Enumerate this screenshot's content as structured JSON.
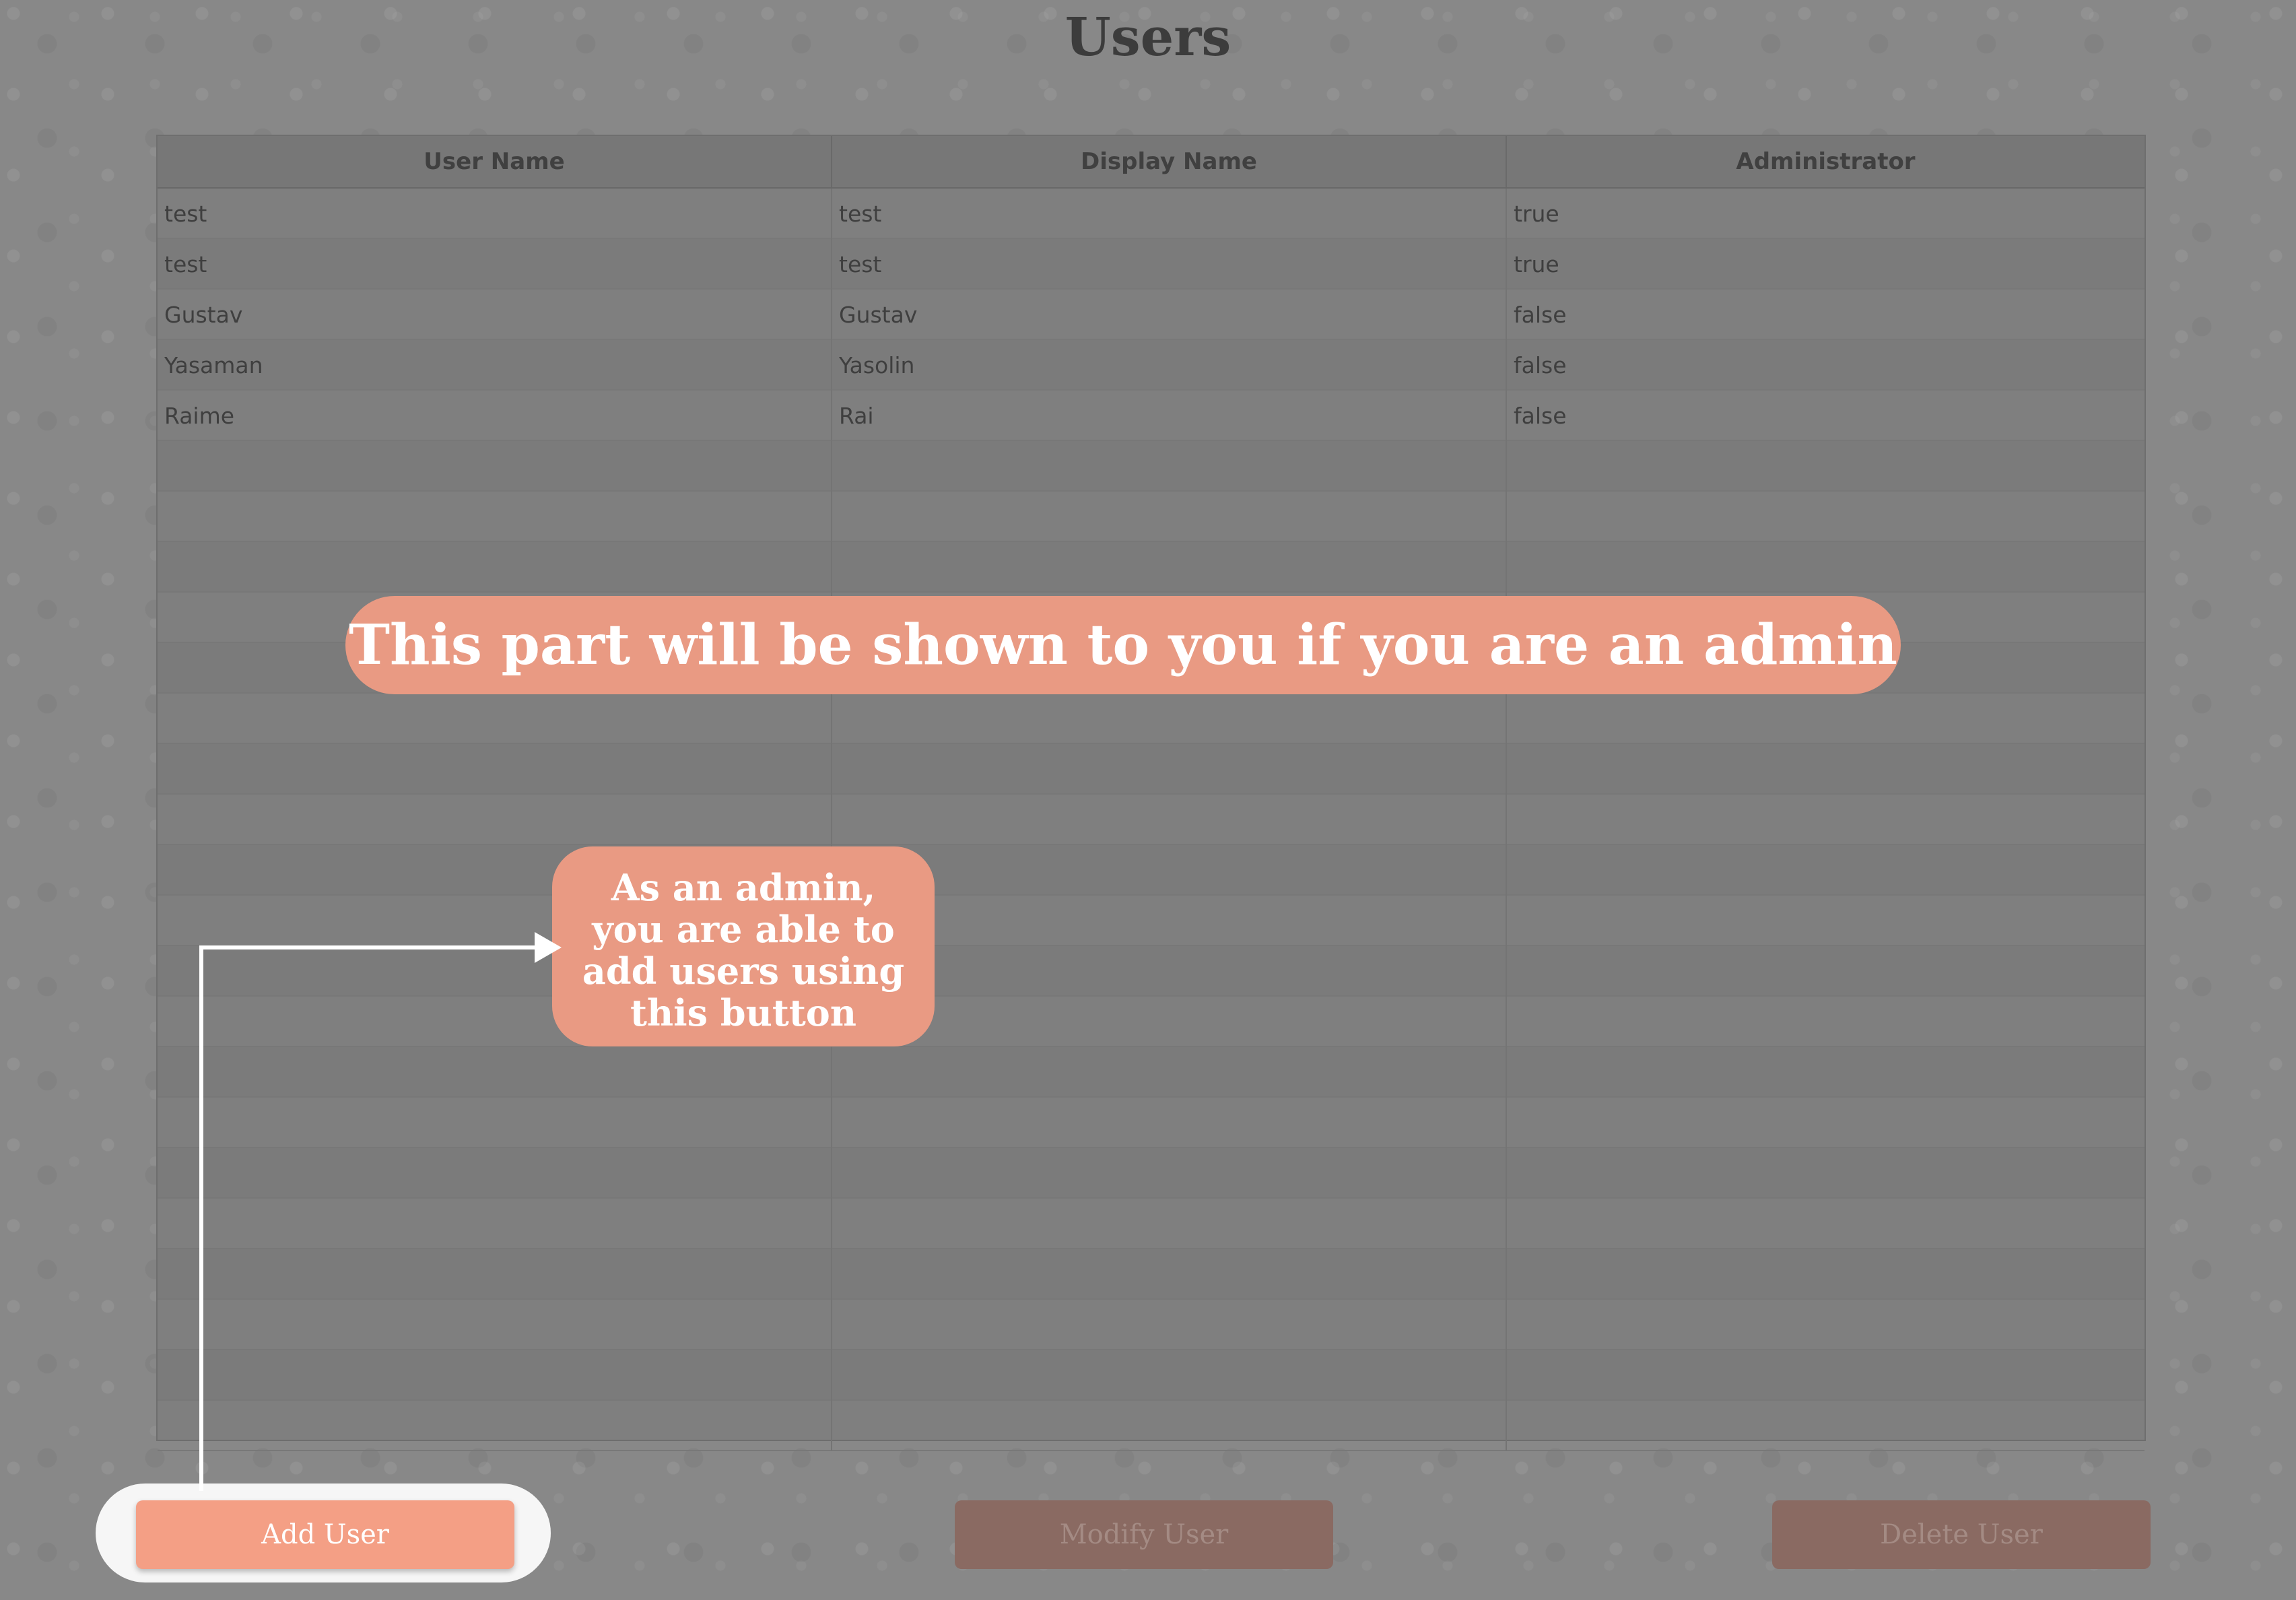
{
  "title": "Users",
  "table": {
    "columns": [
      "User Name",
      "Display Name",
      "Administrator"
    ],
    "rows": [
      {
        "user_name": "test",
        "display_name": "test",
        "administrator": "true"
      },
      {
        "user_name": "test",
        "display_name": "test",
        "administrator": "true"
      },
      {
        "user_name": "Gustav",
        "display_name": "Gustav",
        "administrator": "false"
      },
      {
        "user_name": "Yasaman",
        "display_name": "Yasolin",
        "administrator": "false"
      },
      {
        "user_name": "Raime",
        "display_name": "Rai",
        "administrator": "false"
      }
    ],
    "empty_row_count": 20
  },
  "annotations": {
    "banner": "This part will be shown to you if you are an admin",
    "callout_lines": [
      "As an admin,",
      "you are able to",
      "add users using",
      "this button"
    ]
  },
  "buttons": {
    "add": "Add User",
    "modify": "Modify User",
    "delete": "Delete User"
  },
  "colors": {
    "accent": "#e99a83",
    "button_active": "#f49f85",
    "button_disabled": "#8a6a62"
  }
}
